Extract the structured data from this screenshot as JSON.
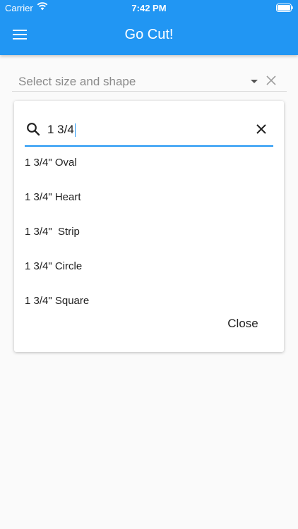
{
  "status_bar": {
    "carrier": "Carrier",
    "time": "7:42 PM"
  },
  "app_bar": {
    "title": "Go Cut!"
  },
  "dropdown": {
    "hint": "Select size and shape"
  },
  "search": {
    "query": "1 3/4"
  },
  "options": [
    {
      "label": "1 3/4\" Oval"
    },
    {
      "label": "1 3/4\" Heart"
    },
    {
      "label": "1 3/4\"  Strip"
    },
    {
      "label": "1 3/4\" Circle"
    },
    {
      "label": "1 3/4\" Square"
    }
  ],
  "dialog": {
    "close_label": "Close"
  },
  "colors": {
    "primary": "#2196f3",
    "background": "#fafafa",
    "card": "#ffffff"
  }
}
